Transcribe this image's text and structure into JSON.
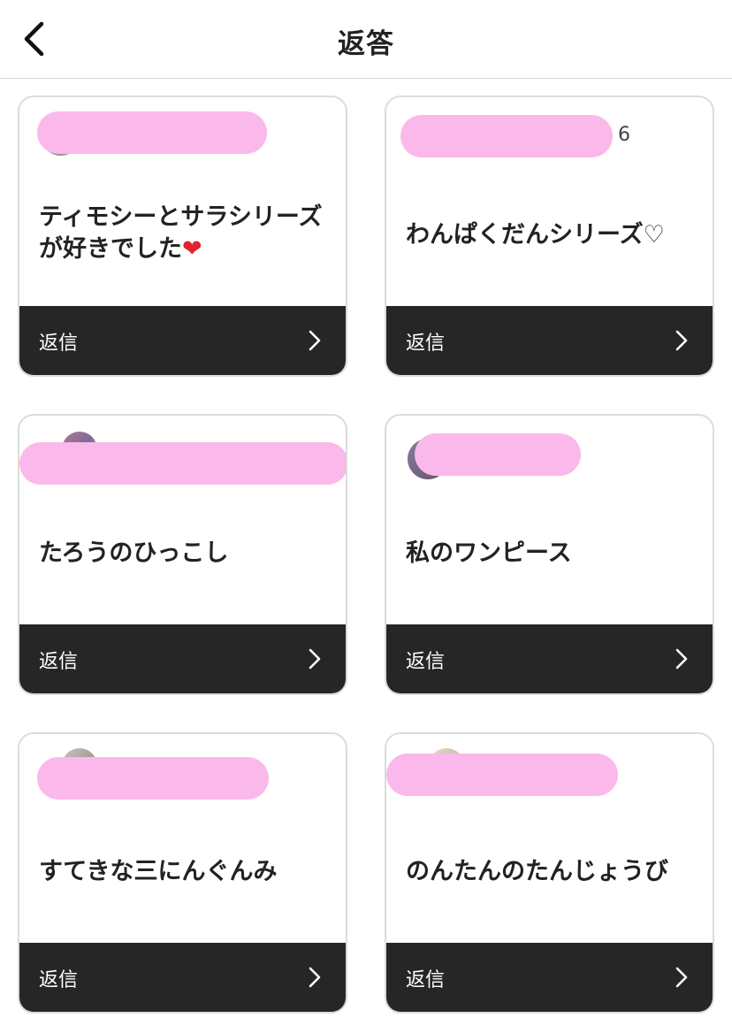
{
  "header": {
    "title": "返答",
    "back_icon": "chevron-left-icon"
  },
  "cards": [
    {
      "username": "",
      "answer": "ティモシーとサラシリーズが好きでした",
      "emoji": "❤",
      "reply_label": "返信"
    },
    {
      "username": "6",
      "answer": "わんぱくだんシリーズ♡",
      "reply_label": "返信"
    },
    {
      "username": "",
      "answer": "たろうのひっこし",
      "reply_label": "返信"
    },
    {
      "username": "",
      "answer": "私のワンピース",
      "reply_label": "返信"
    },
    {
      "username": "",
      "answer": "すてきな三にんぐんみ",
      "reply_label": "返信"
    },
    {
      "username": "",
      "answer": "のんたんのたんじょうび",
      "reply_label": "返信"
    }
  ],
  "colors": {
    "reply_bar": "#262626",
    "redaction": "#fbb8ea",
    "card_border": "#dcdcdc"
  }
}
